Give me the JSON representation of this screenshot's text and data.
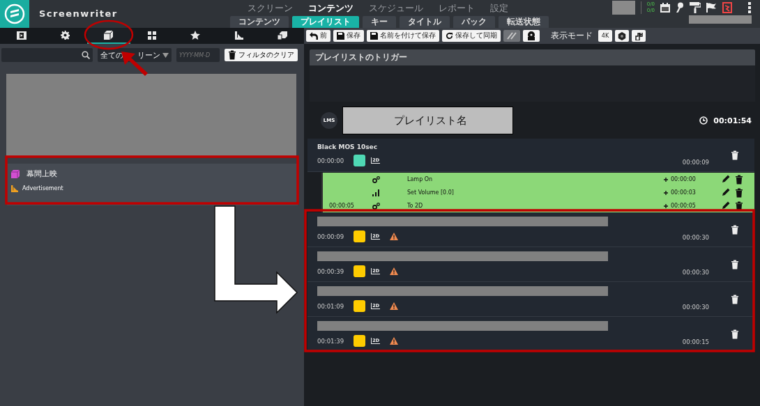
{
  "app": {
    "title": "Screenwriter"
  },
  "main_tabs": [
    {
      "label": "スクリーン",
      "selected": false
    },
    {
      "label": "コンテンツ",
      "selected": true
    },
    {
      "label": "スケジュール",
      "selected": false
    },
    {
      "label": "レポート",
      "selected": false
    },
    {
      "label": "設定",
      "selected": false
    }
  ],
  "sub_tabs": [
    {
      "label": "コンテンツ",
      "selected": false
    },
    {
      "label": "プレイリスト",
      "selected": true
    },
    {
      "label": "キー",
      "selected": false
    },
    {
      "label": "タイトル",
      "selected": false
    },
    {
      "label": "パック",
      "selected": false
    },
    {
      "label": "転送状態",
      "selected": false
    }
  ],
  "status": {
    "counts": [
      "0/0",
      "0/0"
    ]
  },
  "library_tabs": [
    {
      "kind": "film",
      "selected": false
    },
    {
      "kind": "gear",
      "selected": false
    },
    {
      "kind": "cube",
      "selected": true
    },
    {
      "kind": "grid",
      "selected": false
    },
    {
      "kind": "star",
      "selected": false
    },
    {
      "kind": "ruler",
      "selected": false
    },
    {
      "kind": "stack",
      "selected": false
    }
  ],
  "filters": {
    "screen": "全ての",
    "screen_tail": "リーン",
    "date_placeholder": "YYYY-MM-D",
    "clear": "フィルタのクリア"
  },
  "library": [
    {
      "kind": "cube",
      "label": "幕間上映"
    },
    {
      "kind": "ruler",
      "label": "Advertisement"
    }
  ],
  "toolbar": [
    {
      "kind": "back",
      "label": "前",
      "disabled": false
    },
    {
      "kind": "save",
      "label": "保存",
      "disabled": false
    },
    {
      "kind": "save",
      "label": "名前を付けて保存",
      "disabled": false
    },
    {
      "kind": "sync",
      "label": "保存して同期",
      "disabled": false
    },
    {
      "kind": "link",
      "disabled": true
    },
    {
      "kind": "cue",
      "disabled": false
    }
  ],
  "view_mode": {
    "label": "表示モード",
    "buttons": [
      {
        "kind": "text",
        "label": "4K"
      },
      {
        "kind": "hex"
      },
      {
        "kind": "h"
      }
    ]
  },
  "triggers": {
    "title": "プレイリストのトリガー"
  },
  "playlist": {
    "badge": "LMS",
    "name": "プレイリスト名",
    "duration": "00:01:54"
  },
  "items": [
    {
      "kind": "named",
      "title": "Black MOS 10sec",
      "start": "00:00:00",
      "color": "#4fd8b4",
      "format": "2D",
      "warning": false,
      "duration": "00:00:09",
      "cues": [
        {
          "kind": "gears",
          "label": "Lamp On",
          "offset": "00:00:00"
        },
        {
          "kind": "volume",
          "label": "Set Volume [0.0]",
          "offset": "00:00:03"
        },
        {
          "kind": "gears",
          "time": "00:00:05",
          "label": "To 2D",
          "offset": "00:00:05"
        }
      ]
    },
    {
      "kind": "redacted",
      "start": "00:00:09",
      "color": "#ffcc00",
      "format": "2D",
      "warning": true,
      "duration": "00:00:30"
    },
    {
      "kind": "redacted",
      "start": "00:00:39",
      "color": "#ffcc00",
      "format": "2D",
      "warning": true,
      "duration": "00:00:30"
    },
    {
      "kind": "redacted",
      "start": "00:01:09",
      "color": "#ffcc00",
      "format": "2D",
      "warning": true,
      "duration": "00:00:30"
    },
    {
      "kind": "redacted",
      "start": "00:01:39",
      "color": "#ffcc00",
      "format": "2D",
      "warning": true,
      "duration": "00:00:15"
    }
  ]
}
